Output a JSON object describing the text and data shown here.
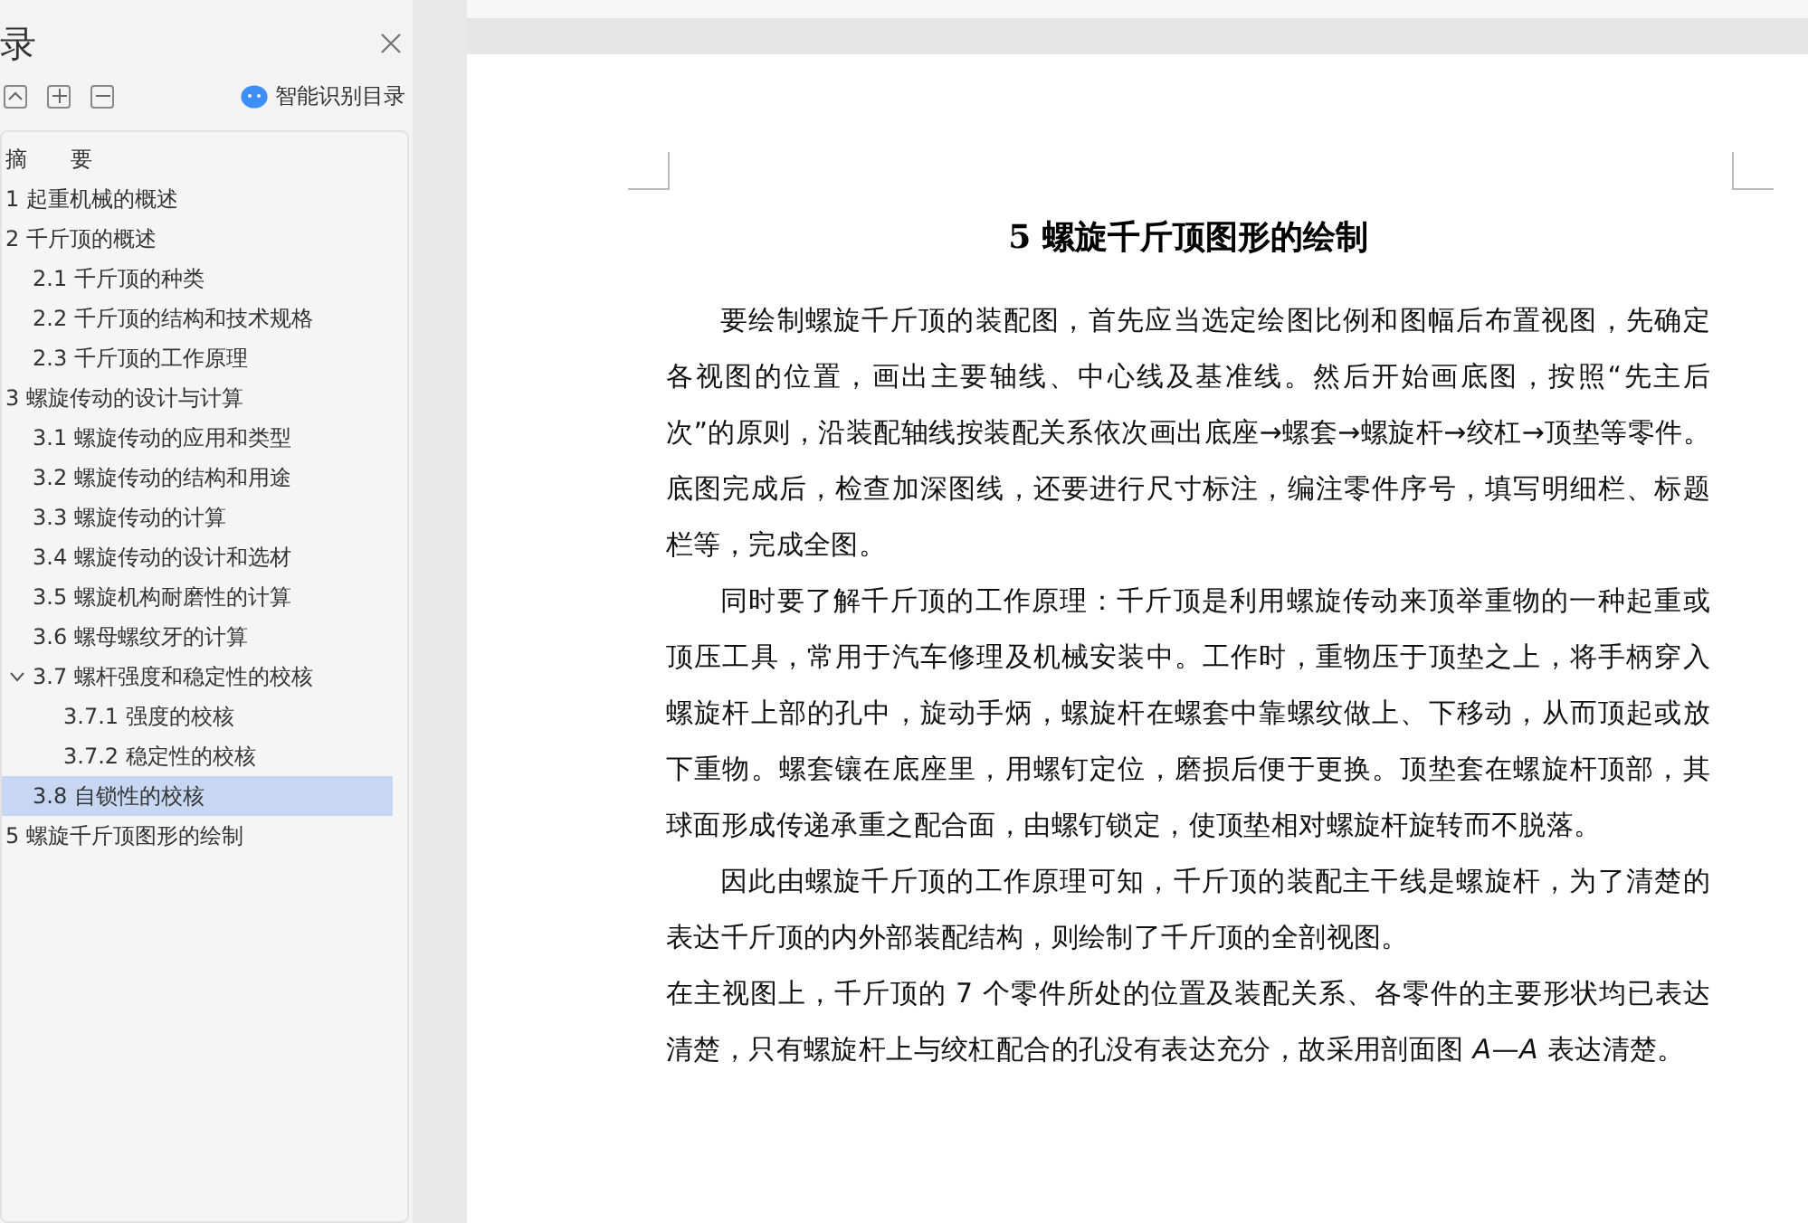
{
  "sidebar": {
    "title": "录",
    "smart_toc_label": "智能识别目录",
    "toc": [
      {
        "label": "摘　　要",
        "selected": false
      },
      {
        "label": "1  起重机械的概述",
        "selected": false
      },
      {
        "label": "2  千斤顶的概述",
        "selected": false,
        "children": [
          {
            "label": "2.1  千斤顶的种类",
            "selected": false
          },
          {
            "label": "2.2  千斤顶的结构和技术规格",
            "selected": false
          },
          {
            "label": "2.3 千斤顶的工作原理",
            "selected": false
          }
        ]
      },
      {
        "label": "3  螺旋传动的设计与计算",
        "selected": false,
        "children": [
          {
            "label": "3.1 螺旋传动的应用和类型",
            "selected": false
          },
          {
            "label": "3.2 螺旋传动的结构和用途",
            "selected": false
          },
          {
            "label": "3.3 螺旋传动的计算",
            "selected": false
          },
          {
            "label": "3.4 螺旋传动的设计和选材",
            "selected": false
          },
          {
            "label": "3.5 螺旋机构耐磨性的计算",
            "selected": false
          },
          {
            "label": "3.6 螺母螺纹牙的计算",
            "selected": false
          },
          {
            "label": "3.7 螺杆强度和稳定性的校核",
            "selected": false,
            "expanded": true,
            "children": [
              {
                "label": "3.7.1 强度的校核",
                "selected": false
              },
              {
                "label": "3.7.2 稳定性的校核",
                "selected": false
              }
            ]
          },
          {
            "label": "3.8 自锁性的校核",
            "selected": true
          }
        ]
      },
      {
        "label": "5  螺旋千斤顶图形的绘制",
        "selected": false
      }
    ]
  },
  "document": {
    "heading": "5  螺旋千斤顶图形的绘制",
    "paragraphs": [
      {
        "indent": true,
        "text": "要绘制螺旋千斤顶的装配图，首先应当选定绘图比例和图幅后布置视图，先确定各视图的位置，画出主要轴线、中心线及基准线。然后开始画底图，按照“先主后次”的原则，沿装配轴线按装配关系依次画出底座→螺套→螺旋杆→绞杠→顶垫等零件。底图完成后，检查加深图线，还要进行尺寸标注，编注零件序号，填写明细栏、标题栏等，完成全图。"
      },
      {
        "indent": true,
        "text": "同时要了解千斤顶的工作原理：千斤顶是利用螺旋传动来顶举重物的一种起重或顶压工具，常用于汽车修理及机械安装中。工作时，重物压于顶垫之上，将手柄穿入螺旋杆上部的孔中，旋动手炳，螺旋杆在螺套中靠螺纹做上、下移动，从而顶起或放下重物。螺套镶在底座里，用螺钉定位，磨损后便于更换。顶垫套在螺旋杆顶部，其球面形成传递承重之配合面，由螺钉锁定，使顶垫相对螺旋杆旋转而不脱落。"
      },
      {
        "indent": true,
        "text": "因此由螺旋千斤顶的工作原理可知，千斤顶的装配主干线是螺旋杆，为了清楚的表达千斤顶的内外部装配结构，则绘制了千斤顶的全剖视图。"
      },
      {
        "indent": false,
        "text": "在主视图上，千斤顶的 7 个零件所处的位置及装配关系、各零件的主要形状均已表达清楚，只有螺旋杆上与绞杠配合的孔没有表达充分，故采用剖面图 *A*—*A* 表达清楚。"
      }
    ]
  }
}
